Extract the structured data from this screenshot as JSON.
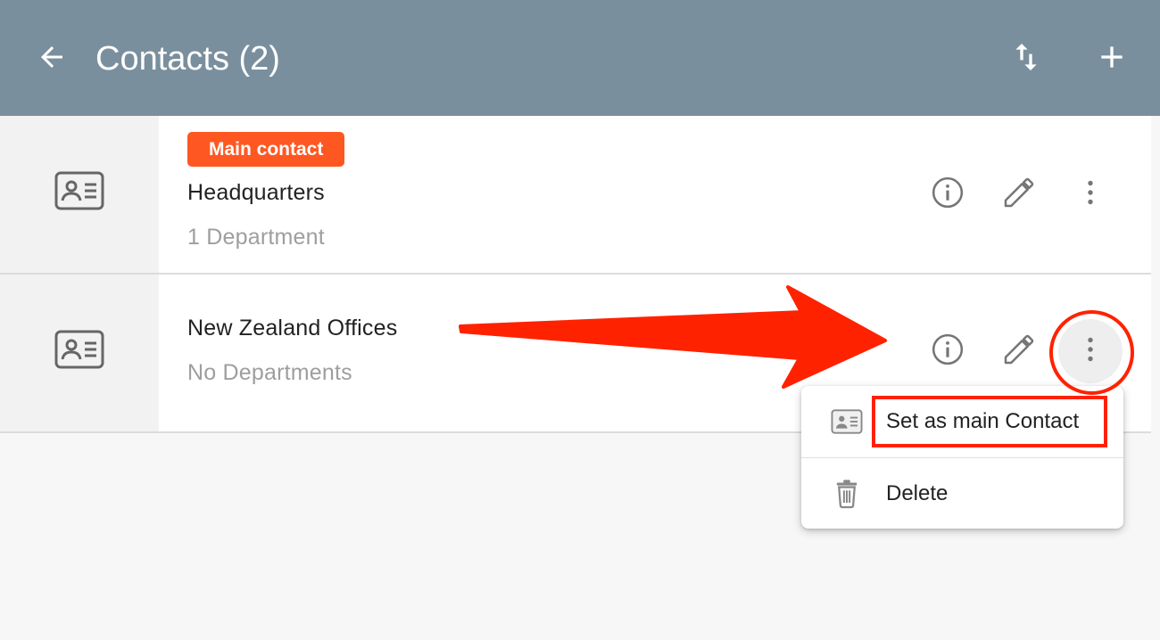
{
  "header": {
    "title": "Contacts (2)",
    "back_icon": "arrow-left-icon",
    "sort_icon": "sort-arrows-icon",
    "add_icon": "plus-icon",
    "background_color": "#7a8f9d"
  },
  "contacts": [
    {
      "badge": "Main contact",
      "name": "Headquarters",
      "subtitle": "1 Department",
      "icon": "contact-card-icon"
    },
    {
      "name": "New Zealand Offices",
      "subtitle": "No Departments",
      "icon": "contact-card-icon"
    }
  ],
  "row_actions": {
    "info_icon": "info-icon",
    "edit_icon": "pencil-icon",
    "more_icon": "more-vertical-icon"
  },
  "context_menu": {
    "items": [
      {
        "label": "Set as main Contact",
        "icon": "contact-card-icon"
      },
      {
        "label": "Delete",
        "icon": "trash-icon"
      }
    ]
  },
  "colors": {
    "badge": "#ff5722",
    "annotation": "#ff2200"
  }
}
